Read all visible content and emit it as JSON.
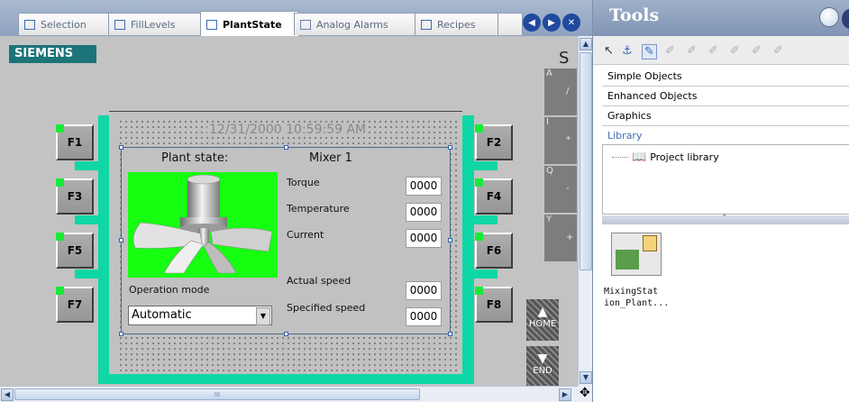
{
  "tabs": [
    {
      "label": "Selection",
      "active": false
    },
    {
      "label": "FillLevels",
      "active": false
    },
    {
      "label": "PlantState",
      "active": true
    },
    {
      "label": "Analog Alarms",
      "active": false
    },
    {
      "label": "Recipes",
      "active": false
    }
  ],
  "screen": {
    "brand": "SIEMENS",
    "corner_letter": "S",
    "datetime": "12/31/2000 10:59:59 AM",
    "plant_state_label": "Plant state:",
    "unit_name": "Mixer 1",
    "torque_label": "Torque",
    "temperature_label": "Temperature",
    "current_label": "Current",
    "actual_speed_label": "Actual speed",
    "specified_speed_label": "Specified speed",
    "torque_value": "0000",
    "temperature_value": "0000",
    "current_value": "0000",
    "actual_speed_value": "0000",
    "specified_speed_value": "0000",
    "operation_mode_label": "Operation mode",
    "operation_mode_value": "Automatic",
    "fkeys_left": [
      "F1",
      "F3",
      "F5",
      "F7"
    ],
    "fkeys_right": [
      "F2",
      "F4",
      "F6",
      "F8"
    ],
    "axis_buttons": [
      {
        "tag": "A",
        "symbol": "/"
      },
      {
        "tag": "I",
        "symbol": "*"
      },
      {
        "tag": "Q",
        "symbol": "-"
      },
      {
        "tag": "Y",
        "symbol": "+"
      }
    ],
    "home_label": "HOME",
    "end_label": "END"
  },
  "tools": {
    "title": "Tools",
    "sections": [
      "Simple Objects",
      "Enhanced Objects",
      "Graphics",
      "Library"
    ],
    "library_item": "Project library",
    "thumbnail_label": "MixingStat ion_Plant...",
    "hscroll_grip": "III"
  },
  "colors": {
    "accent_teal": "#0fd7a6",
    "indicator_green": "#16ff11",
    "brand_bg": "#1d7478",
    "library_blue": "#3b6db8"
  }
}
